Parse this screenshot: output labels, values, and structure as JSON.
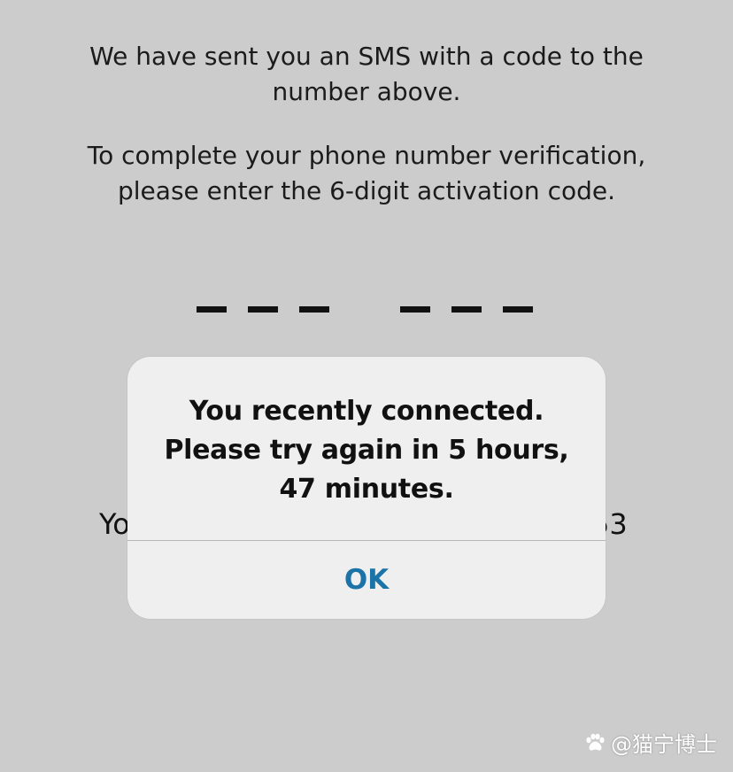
{
  "background": {
    "intro_lines": [
      "We have sent you an SMS with a code to the",
      "number above."
    ],
    "instruction_lines": [
      "To complete your phone number verification,",
      "please enter the 6-digit activation code."
    ],
    "code_slots_filled": 0,
    "partial_left_text": "Yo",
    "partial_right_text": "53"
  },
  "alert": {
    "message_lines": [
      "You recently connected.",
      "Please try again in 5 hours,",
      "47 minutes."
    ],
    "ok_label": "OK",
    "button_color": "#1b73a8"
  },
  "watermark": {
    "icon": "paw-icon",
    "text": "@猫宁博士"
  }
}
